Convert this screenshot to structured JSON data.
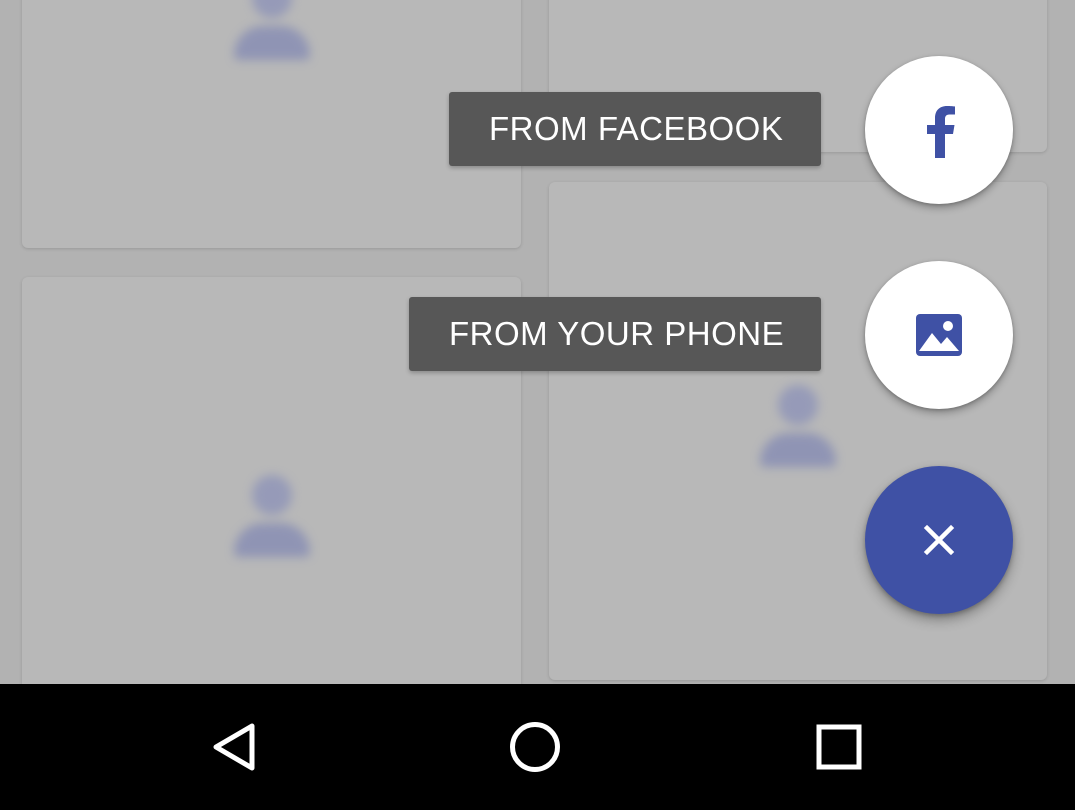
{
  "menu": {
    "facebook_label": "FROM FACEBOOK",
    "phone_label": "FROM YOUR PHONE",
    "facebook_icon": "facebook-icon",
    "phone_icon": "image-icon",
    "close_icon": "close-icon"
  },
  "navigation": {
    "back_icon": "back-triangle-icon",
    "home_icon": "home-circle-icon",
    "recents_icon": "recents-square-icon"
  },
  "colors": {
    "accent": "#3f51a5",
    "scrim": "#b2b2b2",
    "chip_background": "#575757",
    "nav_background": "#000000"
  }
}
